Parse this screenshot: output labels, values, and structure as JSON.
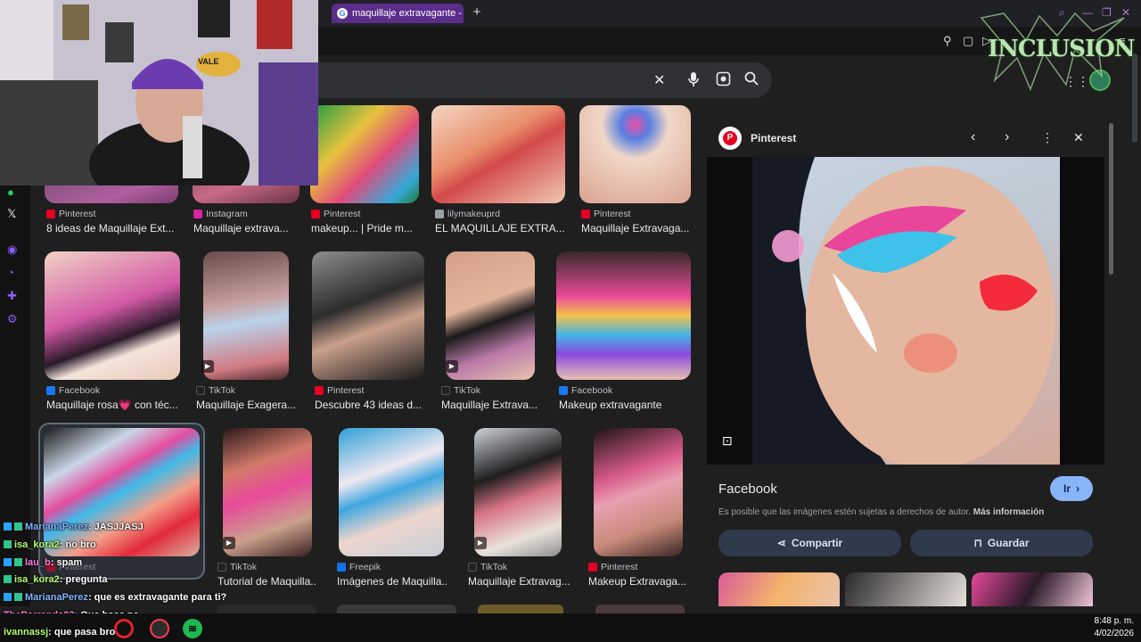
{
  "browser": {
    "tab_title": "maquillaje extravagante - ",
    "new_tab": "+"
  },
  "search": {
    "clear_icon": "✕",
    "mic_icon": "🎙",
    "lens_icon": "◉",
    "search_icon": "⌕"
  },
  "results": [
    {
      "source": "Pinterest",
      "caption": "8 ideas de Maquillaje Ext...",
      "src_color": "#e60023"
    },
    {
      "source": "Instagram",
      "caption": "Maquillaje extrava...",
      "src_color": "#d6249f"
    },
    {
      "source": "Pinterest",
      "caption": "makeup... | Pride m...",
      "src_color": "#e60023"
    },
    {
      "source": "lilymakeuprd",
      "caption": "EL MAQUILLAJE EXTRA...",
      "src_color": "#9aa0a6"
    },
    {
      "source": "Pinterest",
      "caption": "Maquillaje Extravaga...",
      "src_color": "#e60023"
    },
    {
      "source": "Facebook",
      "caption": "Maquillaje rosa💗 con téc...",
      "src_color": "#1877f2"
    },
    {
      "source": "TikTok",
      "caption": "Maquillaje Exagera...",
      "src_color": "#222222"
    },
    {
      "source": "Pinterest",
      "caption": "Descubre 43 ideas d...",
      "src_color": "#e60023"
    },
    {
      "source": "TikTok",
      "caption": "Maquillaje Extrava...",
      "src_color": "#222222"
    },
    {
      "source": "Facebook",
      "caption": "Makeup extravagante",
      "src_color": "#1877f2"
    },
    {
      "source": "Pinterest",
      "caption": "",
      "src_color": "#e60023"
    },
    {
      "source": "TikTok",
      "caption": "Tutorial de Maquilla...",
      "src_color": "#222222"
    },
    {
      "source": "Freepik",
      "caption": "Imágenes de Maquilla...",
      "src_color": "#1273eb"
    },
    {
      "source": "TikTok",
      "caption": "Maquillaje Extravag...",
      "src_color": "#222222"
    },
    {
      "source": "Pinterest",
      "caption": "Makeup Extravaga...",
      "src_color": "#e60023"
    }
  ],
  "panel": {
    "site_name": "Pinterest",
    "title": "Facebook",
    "copyright": "Es posible que las imágenes estén sujetas a derechos de autor.",
    "more_info": "Más información",
    "go_label": "Ir",
    "share_label": "Compartir",
    "save_label": "Guardar"
  },
  "chat": [
    {
      "user": "MarianaPerez",
      "msg": ": JASJJASJ"
    },
    {
      "user": "isa_kora2",
      "msg": ": no bro"
    },
    {
      "user": "lau_b",
      "msg": ": spam"
    },
    {
      "user": "isa_kora2",
      "msg": ": pregunta"
    },
    {
      "user": "MarianaPerez",
      "msg": ": que es extravagante para ti?"
    },
    {
      "user": "TheParranda03",
      "msg": ": Que hace ne"
    },
    {
      "user": "ivannassj",
      "msg": ": que pasa bro"
    }
  ],
  "taskbar": {
    "time": "8:48 p. m.",
    "date": "4/02/2026"
  },
  "overlay": {
    "logo_text": "INCLUSION",
    "webcam_sign": "VALE"
  }
}
